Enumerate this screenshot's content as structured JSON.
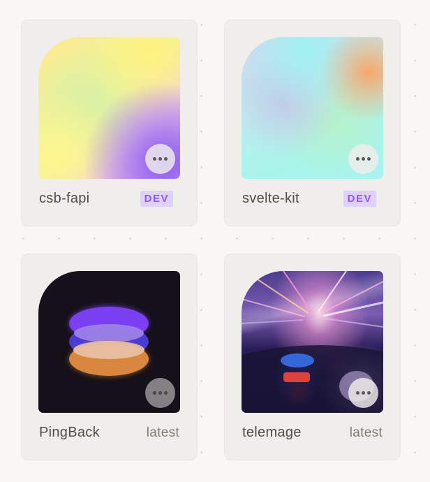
{
  "cards": [
    {
      "name": "csb-fapi",
      "label": "DEV",
      "label_style": "badge",
      "thumbnail": "yellow-purple-gradient"
    },
    {
      "name": "svelte-kit",
      "label": "DEV",
      "label_style": "badge",
      "thumbnail": "mint-pastel-gradient"
    },
    {
      "name": "PingBack",
      "label": "latest",
      "label_style": "tag",
      "thumbnail": "stacked-discs-logo"
    },
    {
      "name": "telemage",
      "label": "latest",
      "label_style": "tag",
      "thumbnail": "light-trails-photo"
    }
  ],
  "colors": {
    "background": "#f8f7f5",
    "card": "#efeeeb",
    "badge_bg": "#ded2fb",
    "badge_text": "#8f58f0",
    "disc_purple": "#7a3ff0",
    "disc_blue": "#4b3bd6",
    "disc_orange": "#d9873e"
  },
  "icons": {
    "menu": "more-horizontal-icon"
  }
}
